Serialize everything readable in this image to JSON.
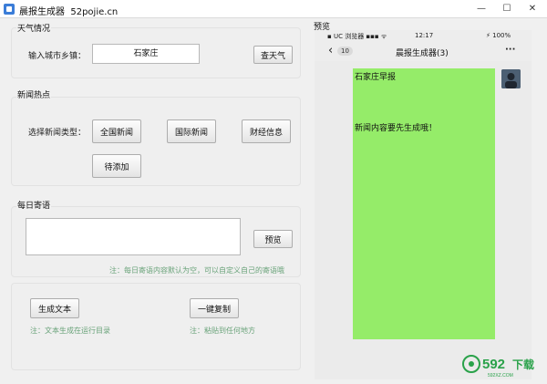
{
  "window": {
    "title": "晨报生成器",
    "subtitle": "52pojie.cn",
    "minimize": "—",
    "maximize": "☐",
    "close": "✕"
  },
  "weather": {
    "group_title": "天气情况",
    "city_label": "输入城市乡镇：",
    "city_value": "石家庄",
    "query_button": "查天气"
  },
  "news": {
    "group_title": "新闻热点",
    "type_label": "选择新闻类型：",
    "buttons": [
      "全国新闻",
      "国际新闻",
      "财经信息",
      "待添加"
    ]
  },
  "daily_quote": {
    "group_title": "每日寄语",
    "text_value": "",
    "preview_button": "预览",
    "note": "注：每日寄语内容默认为空，可以自定义自己的寄语哦"
  },
  "actions": {
    "generate_button": "生成文本",
    "generate_note": "注：文本生成在运行目录",
    "copy_button": "一键复制",
    "copy_note": "注：粘贴到任何地方"
  },
  "preview": {
    "title": "预览",
    "status_left": "▪ UC 浏览器 ▪▪▪ ᯤ",
    "status_time": "12:17",
    "status_right": "⚡ 100%",
    "back_count": "10",
    "chat_title": "晨报生成器(3)",
    "more": "···",
    "message_heading": "石家庄早报",
    "message_body": "新闻内容要先生成哦！"
  },
  "watermark": {
    "number": "592",
    "text": "下载",
    "site": "592XZ.COM"
  },
  "colors": {
    "bubble": "#95ec69",
    "note": "#6aa37a",
    "watermark": "#2aa24a"
  }
}
